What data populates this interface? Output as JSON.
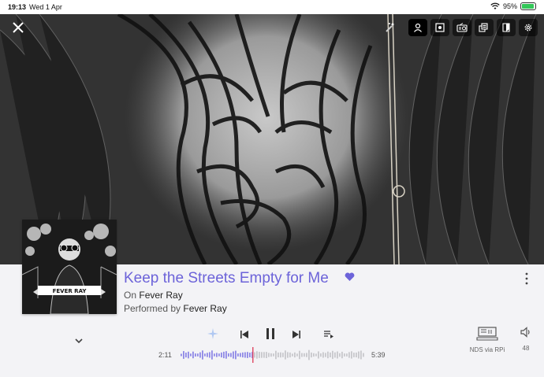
{
  "status_bar": {
    "time": "19:13",
    "date": "Wed 1 Apr",
    "battery": "95%",
    "battery_level": 0.95
  },
  "hero": {
    "toolbar": [
      {
        "name": "artist-icon",
        "active": true
      },
      {
        "name": "album-icon",
        "active": false
      },
      {
        "name": "radio-icon",
        "active": false
      },
      {
        "name": "similar-icon",
        "active": false
      },
      {
        "name": "lyrics-icon",
        "active": false
      },
      {
        "name": "settings-icon",
        "active": false
      }
    ]
  },
  "track": {
    "title": "Keep the Streets Empty for Me",
    "album_prefix": "On",
    "album": "Fever Ray",
    "performer_prefix": "Performed by",
    "performer": "Fever Ray",
    "favorite": true,
    "cover_text": "FEVER RAY"
  },
  "playback": {
    "elapsed": "2:11",
    "duration": "5:39",
    "progress": 0.39,
    "state": "playing"
  },
  "output": {
    "device": "NDS via RPi",
    "volume": "48"
  },
  "colors": {
    "accent": "#6c63d9",
    "playhead": "#e0506a",
    "played_wave": "#8e88e6",
    "unplayed_wave": "#c8c8cc"
  }
}
